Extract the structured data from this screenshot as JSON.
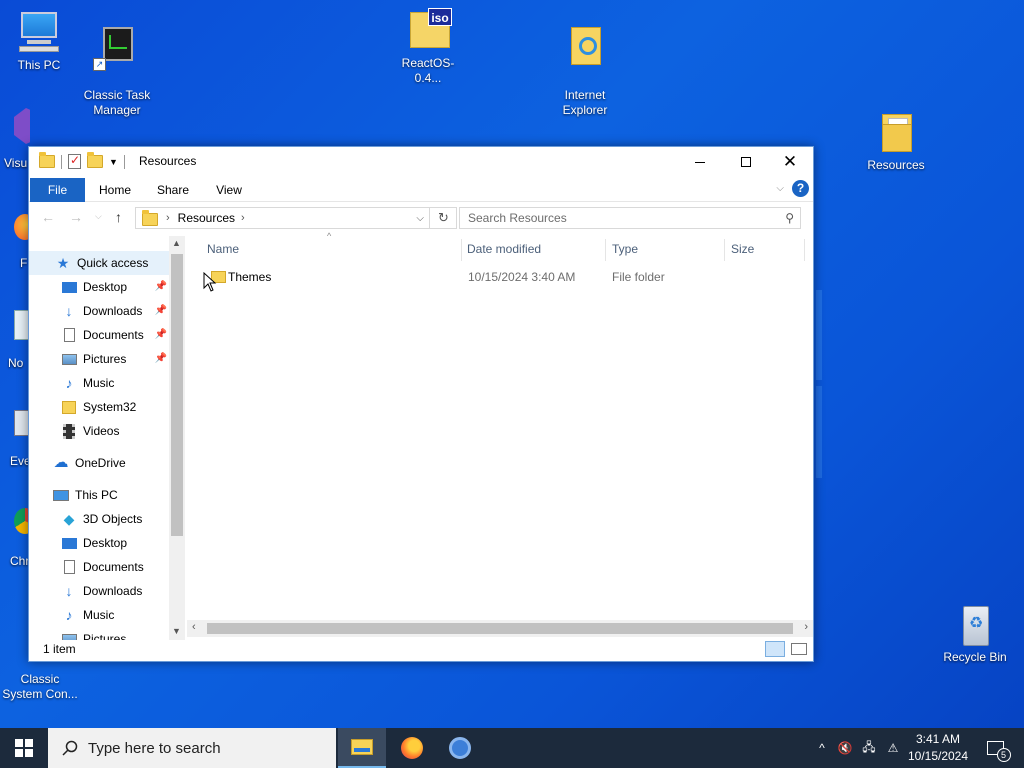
{
  "desktop": {
    "icons": [
      {
        "label": "This PC"
      },
      {
        "label": "Classic Task\nManager"
      },
      {
        "label": "ReactOS-0.4..."
      },
      {
        "label": "Internet\nExplorer"
      },
      {
        "label": "Resources"
      },
      {
        "label": "Recycle Bin"
      },
      {
        "label": "Visu"
      },
      {
        "label": "F"
      },
      {
        "label": "No"
      },
      {
        "label": "Eve"
      },
      {
        "label": "Chr"
      },
      {
        "label": "Classic\nSystem Con..."
      }
    ]
  },
  "window": {
    "title": "Resources",
    "ribbon_tabs": [
      "File",
      "Home",
      "Share",
      "View"
    ],
    "address": {
      "crumb": "Resources"
    },
    "search": {
      "placeholder": "Search Resources"
    },
    "nav_pane": {
      "quick_access": "Quick access",
      "quick_items": [
        "Desktop",
        "Downloads",
        "Documents",
        "Pictures",
        "Music",
        "System32",
        "Videos"
      ],
      "onedrive": "OneDrive",
      "this_pc": "This PC",
      "pc_items": [
        "3D Objects",
        "Desktop",
        "Documents",
        "Downloads",
        "Music",
        "Pictures"
      ]
    },
    "columns": [
      "Name",
      "Date modified",
      "Type",
      "Size"
    ],
    "files": [
      {
        "name": "Themes",
        "date_modified": "10/15/2024 3:40 AM",
        "type": "File folder",
        "size": ""
      }
    ],
    "status": "1 item"
  },
  "taskbar": {
    "search_placeholder": "Type here to search",
    "clock_time": "3:41 AM",
    "clock_date": "10/15/2024",
    "notification_count": "5"
  },
  "colors": {
    "accent": "#1a64c4",
    "desktop": "#0a55d8",
    "taskbar": "#1c2a3c"
  }
}
